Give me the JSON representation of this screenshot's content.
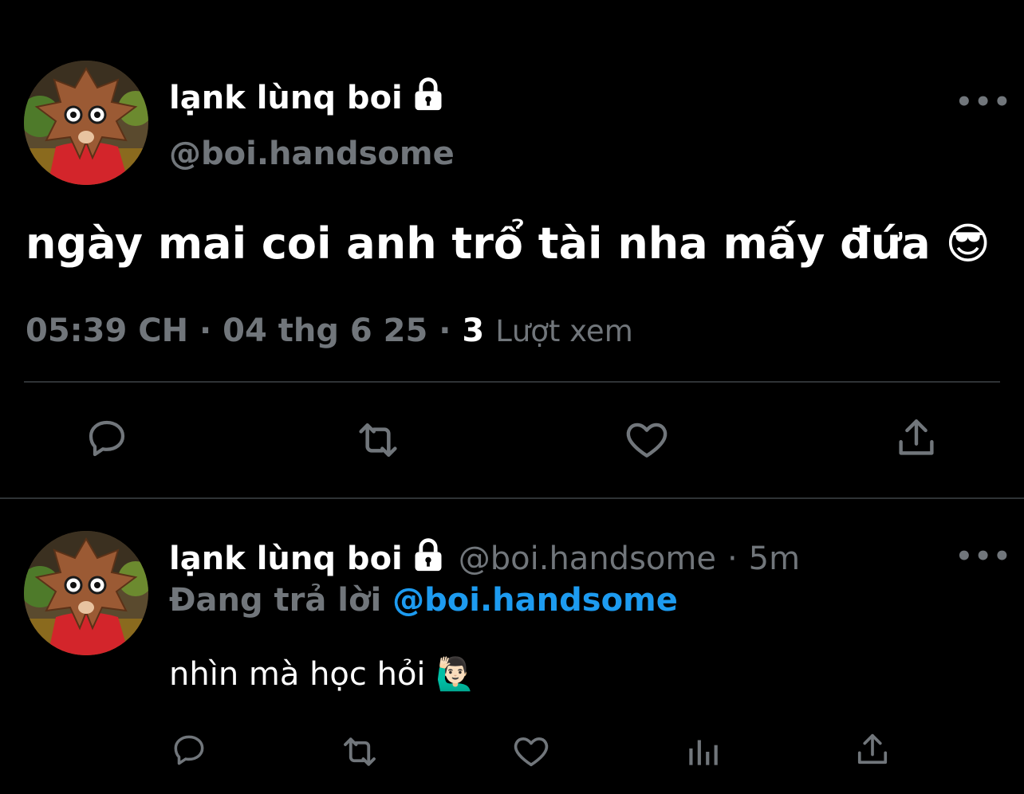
{
  "tweet": {
    "display_name": "lạnk lùnq boi",
    "handle": "@boi.handsome",
    "text": "ngày mai coi anh trổ tài nha mấy đứa",
    "emoji": "😎",
    "time": "05:39 CH",
    "date": "04 thg 6 25",
    "views_count": "3",
    "views_label": "Lượt xem",
    "more_label": "•••",
    "separator": "·"
  },
  "reply": {
    "display_name": "lạnk lùnq boi",
    "handle": "@boi.handsome",
    "age": "5m",
    "separator": "·",
    "replying_label": "Đang trả lời",
    "replying_to": "@boi.handsome",
    "text": "nhìn mà học hỏi",
    "emoji": "🙋🏻‍♂️",
    "more_label": "•••"
  },
  "icons": {
    "tweet_actions": [
      "reply-icon",
      "retweet-icon",
      "like-icon",
      "share-icon"
    ],
    "reply_actions": [
      "reply-icon",
      "retweet-icon",
      "like-icon",
      "analytics-icon",
      "share-icon"
    ],
    "lock": "lock-icon"
  },
  "colors": {
    "background": "#000000",
    "text": "#ffffff",
    "muted": "#71767b",
    "link": "#1d9bf0",
    "divider": "#2f3336"
  }
}
